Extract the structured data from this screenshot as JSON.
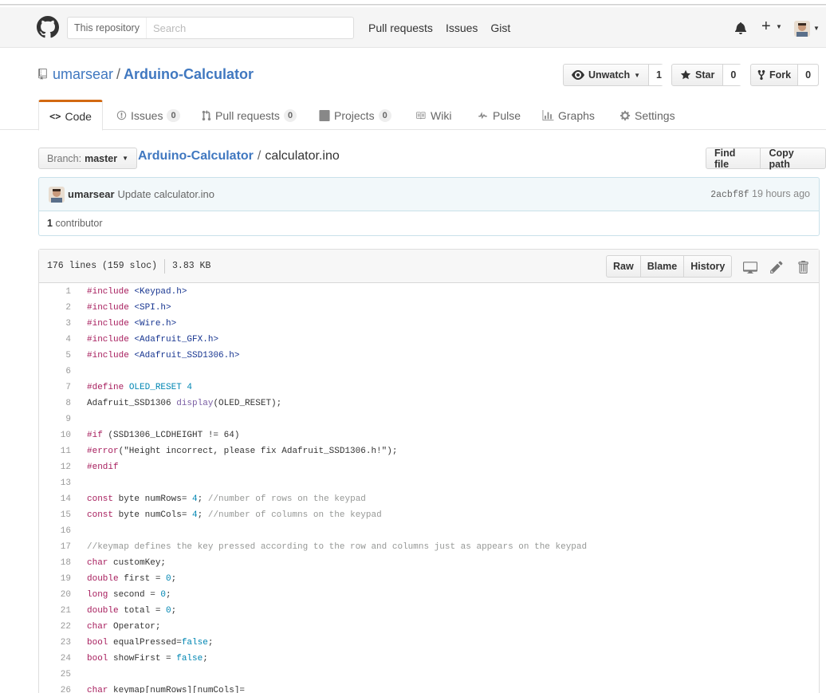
{
  "header": {
    "scope_label": "This repository",
    "search_placeholder": "Search",
    "nav": [
      "Pull requests",
      "Issues",
      "Gist"
    ],
    "plus_label": "+"
  },
  "repo": {
    "owner": "umarsear",
    "separator": "/",
    "name": "Arduino-Calculator",
    "unwatch_label": "Unwatch",
    "unwatch_count": "1",
    "star_label": "Star",
    "star_count": "0",
    "fork_label": "Fork",
    "fork_count": "0"
  },
  "tabs": {
    "code": "Code",
    "issues": "Issues",
    "issues_count": "0",
    "pulls": "Pull requests",
    "pulls_count": "0",
    "projects": "Projects",
    "projects_count": "0",
    "wiki": "Wiki",
    "pulse": "Pulse",
    "graphs": "Graphs",
    "settings": "Settings"
  },
  "breadcrumb": {
    "branch_label": "Branch:",
    "branch_value": "master",
    "root": "Arduino-Calculator",
    "separator": "/",
    "file": "calculator.ino",
    "find_file": "Find file",
    "copy_path": "Copy path"
  },
  "commit": {
    "author": "umarsear",
    "message": "Update calculator.ino",
    "sha": "2acbf8f",
    "time": "19 hours ago",
    "contributors_count": "1",
    "contributors_label": "contributor"
  },
  "file": {
    "lines_info": "176 lines (159 sloc)",
    "size": "3.83 KB",
    "raw": "Raw",
    "blame": "Blame",
    "history": "History"
  },
  "code_lines": [
    [
      [
        "pp",
        "#include "
      ],
      [
        "str",
        "<Keypad.h>"
      ]
    ],
    [
      [
        "pp",
        "#include "
      ],
      [
        "str",
        "<SPI.h>"
      ]
    ],
    [
      [
        "pp",
        "#include "
      ],
      [
        "str",
        "<Wire.h>"
      ]
    ],
    [
      [
        "pp",
        "#include "
      ],
      [
        "str",
        "<Adafruit_GFX.h>"
      ]
    ],
    [
      [
        "pp",
        "#include "
      ],
      [
        "str",
        "<Adafruit_SSD1306.h>"
      ]
    ],
    [],
    [
      [
        "pp",
        "#define "
      ],
      [
        "num",
        "OLED_RESET 4"
      ]
    ],
    [
      [
        "t",
        "Adafruit_SSD1306 "
      ],
      [
        "fn",
        "display"
      ],
      [
        "t",
        "(OLED_RESET);"
      ]
    ],
    [],
    [
      [
        "pp",
        "#if "
      ],
      [
        "t",
        "(SSD1306_LCDHEIGHT != 64)"
      ]
    ],
    [
      [
        "pp",
        "#error"
      ],
      [
        "t",
        "(\"Height incorrect, please fix Adafruit_SSD1306.h!\");"
      ]
    ],
    [
      [
        "pp",
        "#endif"
      ]
    ],
    [],
    [
      [
        "kw",
        "const"
      ],
      [
        "t",
        " byte numRows= "
      ],
      [
        "num",
        "4"
      ],
      [
        "t",
        "; "
      ],
      [
        "com",
        "//number of rows on the keypad"
      ]
    ],
    [
      [
        "kw",
        "const"
      ],
      [
        "t",
        " byte numCols= "
      ],
      [
        "num",
        "4"
      ],
      [
        "t",
        "; "
      ],
      [
        "com",
        "//number of columns on the keypad"
      ]
    ],
    [],
    [
      [
        "com",
        "//keymap defines the key pressed according to the row and columns just as appears on the keypad"
      ]
    ],
    [
      [
        "kw",
        "char"
      ],
      [
        "t",
        " customKey;"
      ]
    ],
    [
      [
        "kw",
        "double"
      ],
      [
        "t",
        " first = "
      ],
      [
        "num",
        "0"
      ],
      [
        "t",
        ";"
      ]
    ],
    [
      [
        "kw",
        "long"
      ],
      [
        "t",
        " second = "
      ],
      [
        "num",
        "0"
      ],
      [
        "t",
        ";"
      ]
    ],
    [
      [
        "kw",
        "double"
      ],
      [
        "t",
        " total = "
      ],
      [
        "num",
        "0"
      ],
      [
        "t",
        ";"
      ]
    ],
    [
      [
        "kw",
        "char"
      ],
      [
        "t",
        " Operator;"
      ]
    ],
    [
      [
        "kw",
        "bool"
      ],
      [
        "t",
        " equalPressed="
      ],
      [
        "num",
        "false"
      ],
      [
        "t",
        ";"
      ]
    ],
    [
      [
        "kw",
        "bool"
      ],
      [
        "t",
        " showFirst = "
      ],
      [
        "num",
        "false"
      ],
      [
        "t",
        ";"
      ]
    ],
    [],
    [
      [
        "kw",
        "char"
      ],
      [
        "t",
        " keymap[numRows][numCols]="
      ]
    ]
  ]
}
